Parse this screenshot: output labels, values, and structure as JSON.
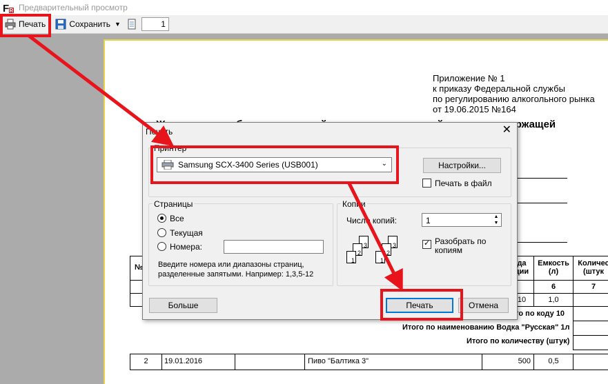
{
  "window": {
    "title": "Предварительный просмотр"
  },
  "toolbar": {
    "print_label": "Печать",
    "save_label": "Сохранить",
    "page_number": "1"
  },
  "document": {
    "annex_lines": [
      "Приложение № 1",
      "к приказу Федеральной службы",
      "по регулированию алкогольного рынка",
      "от 19.06.2015 №164"
    ],
    "title": "Журнал учета объема розничной продажи алкогольной и спиртосодержащей",
    "col_partial": "№",
    "col_a_line1": "да",
    "col_a_line2": "ции",
    "col_volume_line1": "Емкость",
    "col_volume_line2": "(л)",
    "col_qty_line1": "Количес",
    "col_qty_line2": "(штук",
    "num_6": "6",
    "num_7": "7",
    "row1_value": "10",
    "row1_volume": "1,0",
    "total_by_code": "того по коду 10",
    "total_by_name": "Итого по наименованию Водка \"Русская\" 1л",
    "total_by_qty": "Итого по количеству (штук)",
    "row2": {
      "num": "2",
      "date": "19.01.2016",
      "name": "Пиво \"Балтика 3\"",
      "value": "500",
      "volume": "0,5"
    }
  },
  "dialog": {
    "title": "Печать",
    "printer_group": "Принтер",
    "printer_name": "Samsung SCX-3400 Series (USB001)",
    "settings_button": "Настройки...",
    "print_to_file": "Печать в файл",
    "pages_group": "Страницы",
    "radio_all": "Все",
    "radio_current": "Текущая",
    "radio_numbers": "Номера:",
    "hint_line1": "Введите номера или диапазоны страниц,",
    "hint_line2": "разделенные запятыми. Например: 1,3,5-12",
    "copies_group": "Копии",
    "copies_label": "Число копий:",
    "copies_value": "1",
    "collate_line1": "Разобрать по",
    "collate_line2": "копиям",
    "more_button": "Больше",
    "print_button": "Печать",
    "cancel_button": "Отмена"
  },
  "colors": {
    "highlight": "#e8141b",
    "accent": "#0078d7"
  }
}
